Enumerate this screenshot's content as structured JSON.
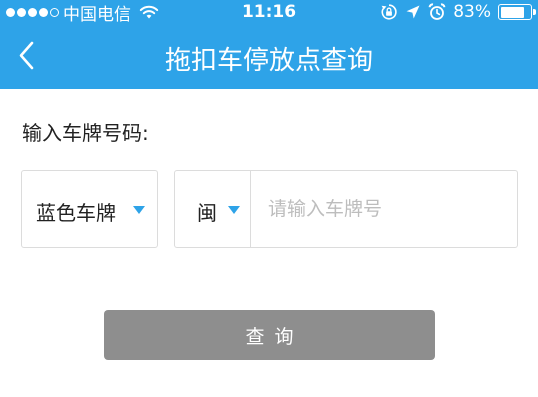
{
  "status_bar": {
    "carrier": "中国电信",
    "time": "11:16",
    "battery_text": "83%",
    "battery_level": 0.83,
    "signal_dots_filled": 4,
    "signal_dots_total": 5
  },
  "nav": {
    "title": "拖扣车停放点查询",
    "back_icon": "chevron-left"
  },
  "form": {
    "label": "输入车牌号码:",
    "plate_type": "蓝色车牌",
    "province": "闽",
    "plate_placeholder": "请输入车牌号",
    "plate_value": "",
    "query_button": "查询"
  },
  "colors": {
    "header_bg": "#2ea3e8",
    "caret": "#2ea3e8",
    "button_bg": "#8e8e8e",
    "border": "#dcdcdc"
  }
}
